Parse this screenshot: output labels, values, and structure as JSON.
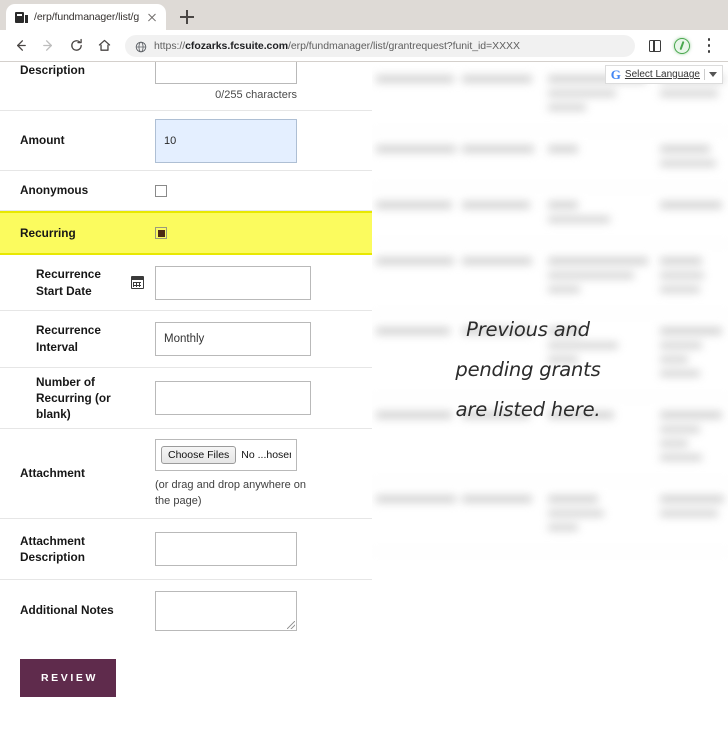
{
  "browser": {
    "tab": {
      "title": "/erp/fundmanager/list/grantre",
      "favicon_name": "fcsuite-favicon"
    },
    "new_tab_label": "+",
    "omnibox": {
      "url_prefix": "https://",
      "url_domain": "cfozarks.fcsuite.com",
      "url_path": "/erp/fundmanager/list/grantrequest?funit_id=XXXX",
      "security_icon": "globe-icon"
    },
    "nav": {
      "back": "back-arrow",
      "forward": "forward-arrow",
      "reload": "reload-arrow",
      "home": "home-icon"
    },
    "actions": {
      "split_view": "split-view-icon",
      "extension": "extension-shield-icon",
      "menu": "three-dot-menu"
    }
  },
  "translate_widget": {
    "logo": "G",
    "label": "Select Language",
    "caret": "dropdown-caret"
  },
  "annotation": {
    "line1": "Previous and",
    "line2": "pending grants",
    "line3": "are listed here."
  },
  "form": {
    "rows": [
      {
        "label": "Description",
        "type": "textarea",
        "value": "",
        "helper": "0/255 characters"
      },
      {
        "label": "Amount",
        "type": "text",
        "value": "10",
        "autofilled": true
      },
      {
        "label": "Anonymous",
        "type": "checkbox",
        "checked": false,
        "highlighted": false
      },
      {
        "label": "Recurring",
        "type": "checkbox",
        "checked": true,
        "highlighted": true
      },
      {
        "label": "Recurrence Start Date",
        "type": "date",
        "value": "",
        "icon": "calendar-icon",
        "indented": true
      },
      {
        "label": "Recurrence Interval",
        "type": "select",
        "value": "Monthly",
        "indented": true
      },
      {
        "label": "Number of Recurring (or blank)",
        "type": "text",
        "value": "",
        "indented": true
      },
      {
        "label": "Attachment",
        "type": "file",
        "button_label": "Choose Files",
        "status_text": "No ...hosen",
        "hint": "(or drag and drop anywhere on the page)"
      },
      {
        "label": "Attachment Description",
        "type": "text",
        "value": ""
      },
      {
        "label": "Additional Notes",
        "type": "textarea",
        "value": ""
      }
    ],
    "submit": {
      "label": "REVIEW",
      "color": "#5f2b4c"
    }
  },
  "colors": {
    "highlight_yellow": "#fbfb5e",
    "highlight_border": "#e8e800",
    "autofill_blue": "#e4efff",
    "brand_purple": "#5f2b4c",
    "checkbox_fill": "#4d2a12"
  }
}
